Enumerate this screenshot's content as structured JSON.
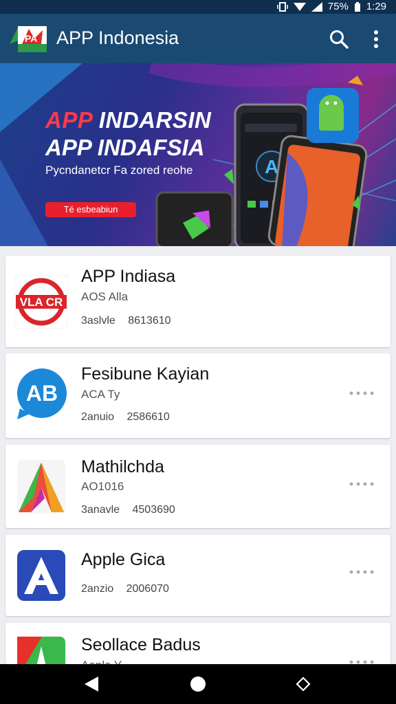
{
  "status": {
    "battery_percent": "75%",
    "time": "1:29"
  },
  "app_bar": {
    "title": "APP Indonesia",
    "icons": [
      "search-icon",
      "more-vert-icon"
    ]
  },
  "banner": {
    "line1_red": "APP",
    "line1_rest": " INDARSIN",
    "line2": "APP INDAFSIA",
    "subtitle": "Pycndanetcr Fa zored reohe",
    "cta_label": "Té esbeabiun"
  },
  "apps": [
    {
      "name": "APP Indiasa",
      "category": "AOS Alla",
      "meta": "3aslvle 8613610",
      "icon": "vla-cr-logo",
      "has_menu": false
    },
    {
      "name": "Fesibune Kayian",
      "category": "ACA Ty",
      "meta": "2anuio 2586610",
      "icon": "ab-chat-logo",
      "has_menu": true
    },
    {
      "name": "Mathilchda",
      "category": "AO1016",
      "meta": "3anavle 4503690",
      "icon": "a-gradient-logo",
      "has_menu": true
    },
    {
      "name": "Apple Gica",
      "category": "",
      "meta": "2anzio 2006070",
      "icon": "a-blue-logo",
      "has_menu": true
    },
    {
      "name": "Seollace Badus",
      "category": "Aonlo Y",
      "meta": "",
      "icon": "a-red-green-logo",
      "has_menu": true
    }
  ],
  "nav": {
    "icons": [
      "back-icon",
      "home-icon",
      "recent-apps-icon"
    ]
  }
}
